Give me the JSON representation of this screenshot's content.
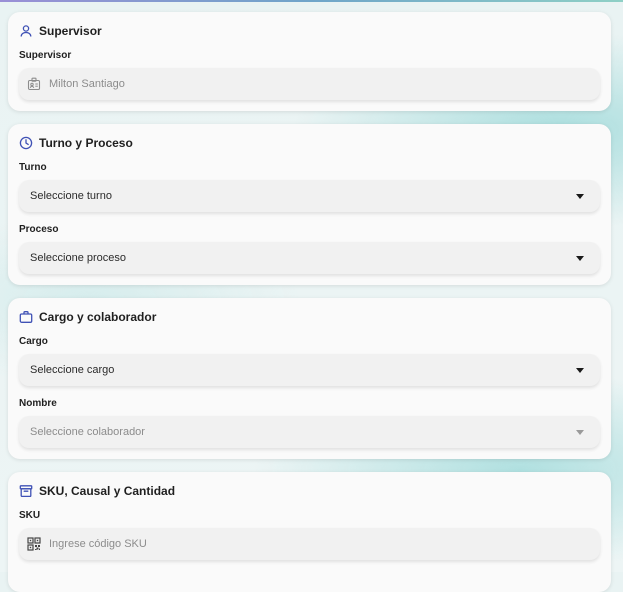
{
  "supervisor": {
    "title": "Supervisor",
    "icon": "person-icon",
    "field_label": "Supervisor",
    "field_value": "Milton Santiago",
    "field_icon": "badge-icon"
  },
  "turno_proceso": {
    "title": "Turno y Proceso",
    "icon": "clock-icon",
    "turno_label": "Turno",
    "turno_placeholder": "Seleccione turno",
    "proceso_label": "Proceso",
    "proceso_placeholder": "Seleccione proceso"
  },
  "cargo_colaborador": {
    "title": "Cargo y colaborador",
    "icon": "briefcase-icon",
    "cargo_label": "Cargo",
    "cargo_placeholder": "Seleccione cargo",
    "nombre_label": "Nombre",
    "nombre_placeholder": "Seleccione colaborador"
  },
  "sku_causal": {
    "title": "SKU, Causal y Cantidad",
    "icon": "archive-box-icon",
    "sku_label": "SKU",
    "sku_placeholder": "Ingrese código SKU",
    "sku_icon": "qr-code-icon"
  },
  "colors": {
    "accent": "#3f51b5",
    "card": "#fafafa",
    "field": "#f1f1f1",
    "background": "#e9f3f3"
  }
}
